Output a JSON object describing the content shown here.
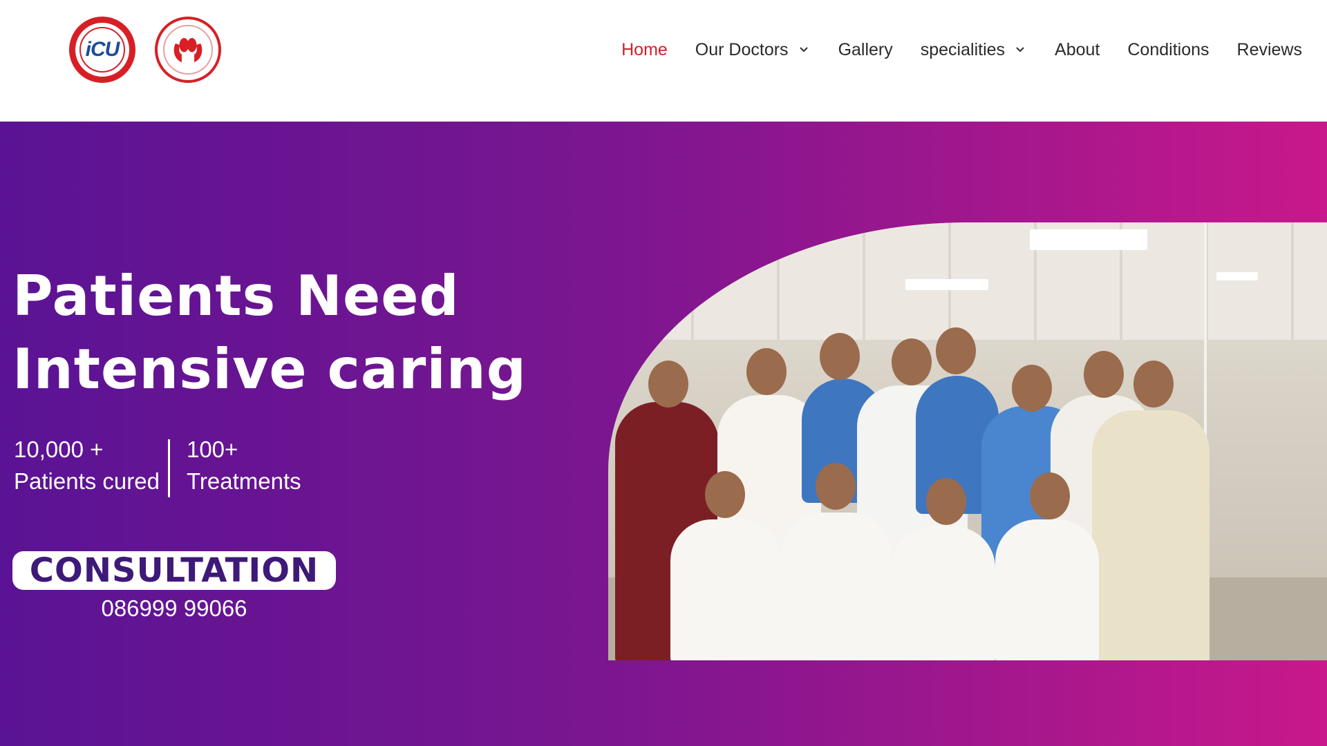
{
  "header": {
    "logos": [
      {
        "name": "garg-clinics-icu-logo",
        "text": "iCU"
      },
      {
        "name": "garg-kidney-clinic-logo",
        "text": ""
      }
    ],
    "nav": [
      {
        "label": "Home",
        "active": true,
        "has_dropdown": false
      },
      {
        "label": "Our Doctors",
        "active": false,
        "has_dropdown": true
      },
      {
        "label": "Gallery",
        "active": false,
        "has_dropdown": false
      },
      {
        "label": "specialities",
        "active": false,
        "has_dropdown": true
      },
      {
        "label": "About",
        "active": false,
        "has_dropdown": false
      },
      {
        "label": "Conditions",
        "active": false,
        "has_dropdown": false
      },
      {
        "label": "Reviews",
        "active": false,
        "has_dropdown": false
      }
    ]
  },
  "hero": {
    "title_line1": "Patients Need",
    "title_line2": "Intensive caring",
    "stats": [
      {
        "value": "10,000 +",
        "label": "Patients cured"
      },
      {
        "value": "100+",
        "label": "Treatments"
      }
    ],
    "cta_label": "CONSULTATION",
    "phone": "086999 99066",
    "photo_alt_icon": "team-photo"
  },
  "colors": {
    "nav_active": "#d21f2a",
    "nav_text": "#2a2a2a",
    "hero_gradient_start": "#5a1394",
    "hero_gradient_end": "#c8188b",
    "cta_text": "#3e1a78",
    "logo_red": "#d81f26"
  }
}
